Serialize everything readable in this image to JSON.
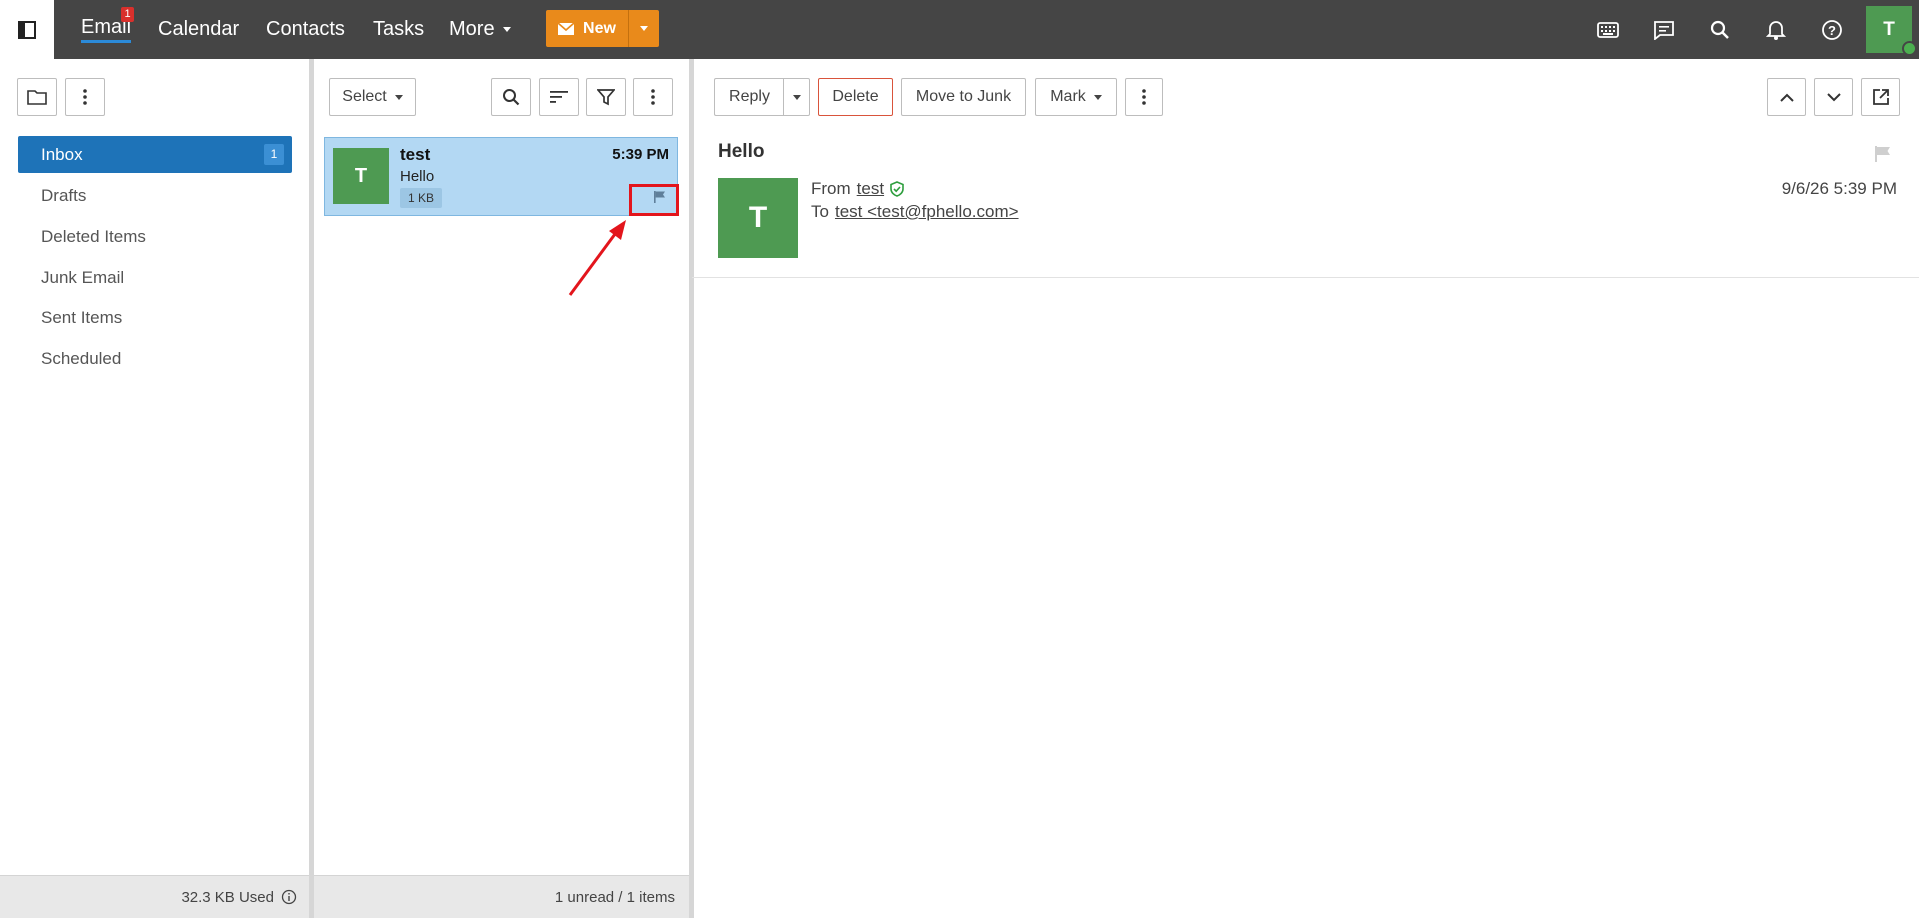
{
  "nav": {
    "items": [
      {
        "label": "Email",
        "badge": "1"
      },
      {
        "label": "Calendar"
      },
      {
        "label": "Contacts"
      },
      {
        "label": "Tasks"
      },
      {
        "label": "More"
      }
    ],
    "new_label": "New"
  },
  "folders": {
    "items": [
      {
        "label": "Inbox",
        "count": "1"
      },
      {
        "label": "Drafts"
      },
      {
        "label": "Deleted Items"
      },
      {
        "label": "Junk Email"
      },
      {
        "label": "Sent Items"
      },
      {
        "label": "Scheduled"
      }
    ],
    "storage": "32.3 KB Used"
  },
  "list": {
    "select_label": "Select",
    "messages": [
      {
        "sender": "test",
        "time": "5:39 PM",
        "subject": "Hello",
        "size": "1 KB",
        "avatar": "T"
      }
    ],
    "footer": "1 unread / 1 items"
  },
  "reading": {
    "toolbar": {
      "reply": "Reply",
      "delete": "Delete",
      "junk": "Move to Junk",
      "mark": "Mark"
    },
    "subject": "Hello",
    "avatar": "T",
    "from_label": "From",
    "from_name": "test",
    "to_label": "To",
    "to_value": "test <test@fphello.com>",
    "date": "9/6/26 5:39 PM"
  },
  "user": {
    "initial": "T"
  },
  "colors": {
    "accent": "#e98a1b",
    "selected": "#1e73b8",
    "avatar": "#4e9a52",
    "annotation": "#e3151c"
  }
}
